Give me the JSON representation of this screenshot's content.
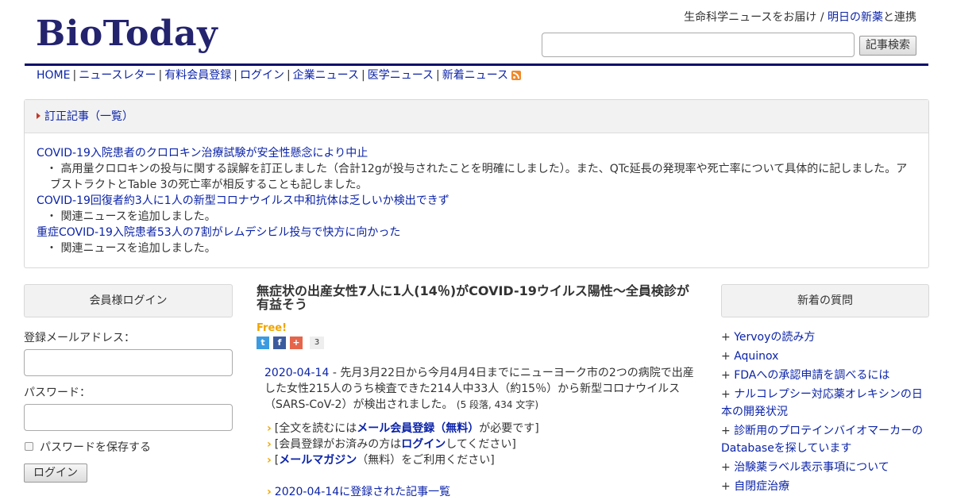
{
  "header": {
    "logo": "BioToday",
    "tagline_pre": "生命科学ニュースをお届け / ",
    "tagline_link": "明日の新薬",
    "tagline_post": "と連携",
    "search_button": "記事検索",
    "search_placeholder": ""
  },
  "nav": {
    "items": [
      "HOME",
      "ニュースレター",
      "有料会員登録",
      "ログイン",
      "企業ニュース",
      "医学ニュース",
      "新着ニュース"
    ],
    "rss_icon": "rss-feed-icon"
  },
  "corrections": {
    "title": "訂正記事（一覧）",
    "items": [
      {
        "headline": "COVID-19入院患者のクロロキン治療試験が安全性懸念により中止",
        "note_line1": "・ 高用量クロロキンの投与に関する誤解を訂正しました（合計12gが投与されたことを明確にしました）。また、QTc延長の発現率や死亡率について具体的に記しました。ア",
        "note_line2": "ブストラクトとTable 3の死亡率が相反することも記しました。"
      },
      {
        "headline": "COVID-19回復者約3人に1人の新型コロナウイルス中和抗体は乏しいか検出できず",
        "note_line1": "・ 関連ニュースを追加しました。"
      },
      {
        "headline": "重症COVID-19入院患者53人の7割がレムデシビル投与で快方に向かった",
        "note_line1": "・ 関連ニュースを追加しました。"
      }
    ]
  },
  "login": {
    "title": "会員様ログイン",
    "email_label": "登録メールアドレス：",
    "password_label": "パスワード：",
    "remember_label": "パスワードを保存する",
    "login_button": "ログイン"
  },
  "article": {
    "title_line1": "無症状の出産女性7人に1人(14％)がCOVID-19ウイルス陽性～全員検診が",
    "title_line2": "有益そう",
    "free": "Free!",
    "share_count": "3",
    "date": "2020-04-14",
    "summary_line1": " - 先月3月22日から今月4月4日までにニューヨーク市の2つの病院で出産",
    "summary_line2": "した女性215人のうち検査できた214人中33人（約15％）から新型コロナウイルス",
    "summary_line3": "（SARS-CoV-2）が検出されました。",
    "meta": "(5 段落, 434 文字)",
    "bullets": [
      {
        "pre": "[全文を読むには",
        "link": "メール会員登録（無料）",
        "post": "が必要です]"
      },
      {
        "pre": "[会員登録がお済みの方は",
        "link": "ログイン",
        "post": "してください]"
      },
      {
        "pre": "[",
        "link": "メールマガジン",
        "post": "（無料）をご利用ください]"
      }
    ],
    "date_list": "2020-04-14に登録された記事一覧"
  },
  "questions": {
    "title": "新着の質問",
    "items": [
      "Yervoyの読み方",
      "Aquinox",
      "FDAへの承認申請を調べるには",
      "ナルコレプシー対応薬オレキシンの日本の開発状況",
      "診断用のプロテインバイオマーカーのDatabaseを探しています",
      "治験薬ラベル表示事項について",
      "自閉症治療"
    ]
  },
  "colors": {
    "link": "#0b23a8",
    "logo": "#24236e",
    "rule": "#0d0d6b",
    "free": "#f0a500",
    "twitter": "#3b9ae0",
    "facebook": "#3b5b9e",
    "google_plus": "#e5654b"
  }
}
